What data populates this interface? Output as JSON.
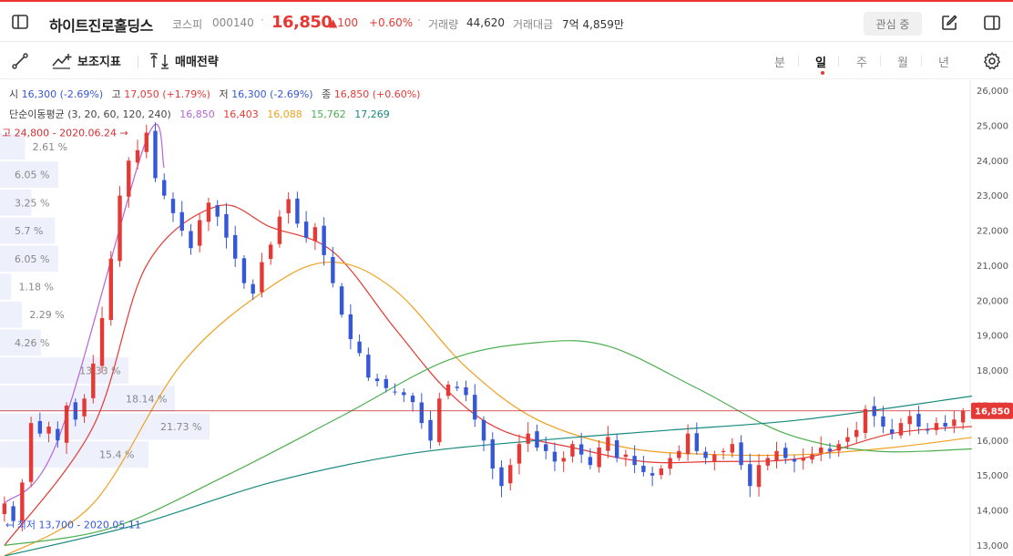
{
  "header": {
    "title": "하이트진로홀딩스",
    "market": "코스피",
    "code": "000140",
    "separator": "·",
    "price": "16,850",
    "change": "▲100",
    "change_pct": "+0.60%",
    "volume_label": "거래량",
    "volume_value": "44,620",
    "amount_label": "거래대금",
    "amount_value": "7억 4,859만",
    "watch_label": "관심 중"
  },
  "toolbar": {
    "indicator_label": "보조지표",
    "strategy_label": "매매전략",
    "periods": [
      "분",
      "일",
      "주",
      "월",
      "년"
    ],
    "active_period": "일"
  },
  "ohlc": {
    "open_label": "시",
    "open": "16,300 (-2.69%)",
    "high_label": "고",
    "high": "17,050 (+1.79%)",
    "low_label": "저",
    "low": "16,300 (-2.69%)",
    "close_label": "종",
    "close": "16,850 (+0.60%)"
  },
  "moving_average": {
    "label": "단순이동평균 (3, 20, 60, 120, 240)",
    "values": [
      {
        "value": "16,850",
        "color": "#b565d8"
      },
      {
        "value": "16,403",
        "color": "#e53935"
      },
      {
        "value": "16,088",
        "color": "#f0a020"
      },
      {
        "value": "15,762",
        "color": "#4caf50"
      },
      {
        "value": "17,269",
        "color": "#17897f"
      }
    ]
  },
  "colors": {
    "up": "#e53935",
    "down": "#3558d8",
    "accent": "#e53935"
  },
  "chart_data": {
    "type": "candlestick",
    "ylim": [
      12700,
      26300
    ],
    "y_ticks": [
      "26,000",
      "25,000",
      "24,000",
      "23,000",
      "22,000",
      "21,000",
      "20,000",
      "19,000",
      "18,000",
      "17,000",
      "16,000",
      "15,000",
      "14,000",
      "13,000"
    ],
    "y_tick_values": [
      26000,
      25000,
      24000,
      23000,
      22000,
      21000,
      20000,
      19000,
      18000,
      17000,
      16000,
      15000,
      14000,
      13000
    ],
    "current_price_label": "16,850",
    "current_price": 16850,
    "high_annotation": "고 24,800 - 2020.06.24 →",
    "high_value": 24800,
    "low_annotation": "← 최저 13,700 - 2020.05.11",
    "low_value": 13700,
    "volume_profile": [
      {
        "price_from": 24000,
        "price_to": 24800,
        "pct": 2.61,
        "label": "2.61 %"
      },
      {
        "price_from": 23200,
        "price_to": 24000,
        "pct": 6.05,
        "label": "6.05 %"
      },
      {
        "price_from": 22400,
        "price_to": 23200,
        "pct": 3.25,
        "label": "3.25 %"
      },
      {
        "price_from": 21600,
        "price_to": 22400,
        "pct": 5.7,
        "label": "5.7 %"
      },
      {
        "price_from": 20800,
        "price_to": 21600,
        "pct": 6.05,
        "label": "6.05 %"
      },
      {
        "price_from": 20000,
        "price_to": 20800,
        "pct": 1.18,
        "label": "1.18 %"
      },
      {
        "price_from": 19200,
        "price_to": 20000,
        "pct": 2.29,
        "label": "2.29 %"
      },
      {
        "price_from": 18400,
        "price_to": 19200,
        "pct": 4.26,
        "label": "4.26 %"
      },
      {
        "price_from": 17600,
        "price_to": 18400,
        "pct": 13.33,
        "label": "13.33 %"
      },
      {
        "price_from": 16800,
        "price_to": 17600,
        "pct": 18.14,
        "label": "18.14 %"
      },
      {
        "price_from": 16000,
        "price_to": 16800,
        "pct": 21.73,
        "label": "21.73 %"
      },
      {
        "price_from": 15200,
        "price_to": 16000,
        "pct": 15.4,
        "label": "15.4 %"
      }
    ],
    "close_path": [
      14200,
      13700,
      14800,
      16500,
      16200,
      16400,
      16000,
      17000,
      16600,
      17200,
      18200,
      19500,
      21200,
      23000,
      24000,
      24300,
      24800,
      23500,
      23000,
      22500,
      22000,
      21500,
      22300,
      22800,
      22400,
      21800,
      21200,
      20500,
      20200,
      21100,
      21600,
      22400,
      22900,
      22200,
      21800,
      22100,
      21300,
      20500,
      19600,
      18900,
      18500,
      17800,
      17700,
      17500,
      17400,
      17300,
      17100,
      16500,
      16000,
      17200,
      17600,
      17500,
      17300,
      16600,
      16000,
      15200,
      14700,
      15300,
      15900,
      16200,
      15800,
      15700,
      15400,
      15500,
      15900,
      15600,
      15300,
      15800,
      16100,
      15500,
      15600,
      15300,
      15100,
      15000,
      15200,
      15500,
      15700,
      16200,
      15700,
      15500,
      15600,
      15700,
      15900,
      15300,
      14700,
      15300,
      15500,
      15700,
      15500,
      15400,
      15500,
      15600,
      15800,
      15700,
      15900,
      16100,
      16300,
      16900,
      16700,
      16400,
      16200,
      16500,
      16700,
      16400,
      16300,
      16500,
      16400,
      16600,
      16850
    ],
    "ma_lines": [
      {
        "period": 3,
        "color": "#b565d8",
        "points": [
          [
            0,
            14200
          ],
          [
            6,
            16000
          ],
          [
            16,
            24600
          ],
          [
            18,
            23800
          ]
        ]
      },
      {
        "period": 20,
        "color": "#e53935",
        "points": [
          [
            0,
            13000
          ],
          [
            10,
            16400
          ],
          [
            16,
            21000
          ],
          [
            24,
            22700
          ],
          [
            30,
            22100
          ],
          [
            37,
            21400
          ],
          [
            44,
            19200
          ],
          [
            50,
            17400
          ],
          [
            56,
            16300
          ],
          [
            64,
            15800
          ],
          [
            72,
            15400
          ],
          [
            80,
            15400
          ],
          [
            90,
            15500
          ],
          [
            100,
            16200
          ],
          [
            109,
            16403
          ]
        ]
      },
      {
        "period": 60,
        "color": "#f0a020",
        "points": [
          [
            0,
            12700
          ],
          [
            10,
            14200
          ],
          [
            20,
            18200
          ],
          [
            30,
            20400
          ],
          [
            37,
            21100
          ],
          [
            44,
            20300
          ],
          [
            52,
            18100
          ],
          [
            60,
            16600
          ],
          [
            70,
            15800
          ],
          [
            80,
            15600
          ],
          [
            90,
            15600
          ],
          [
            100,
            15800
          ],
          [
            109,
            16088
          ]
        ]
      },
      {
        "period": 120,
        "color": "#4caf50",
        "points": [
          [
            0,
            13000
          ],
          [
            12,
            13500
          ],
          [
            25,
            15000
          ],
          [
            38,
            16700
          ],
          [
            50,
            18300
          ],
          [
            60,
            18800
          ],
          [
            68,
            18700
          ],
          [
            78,
            17500
          ],
          [
            88,
            16200
          ],
          [
            98,
            15700
          ],
          [
            109,
            15762
          ]
        ]
      },
      {
        "period": 240,
        "color": "#17897f",
        "points": [
          [
            0,
            12700
          ],
          [
            15,
            13600
          ],
          [
            30,
            14800
          ],
          [
            45,
            15600
          ],
          [
            60,
            16000
          ],
          [
            75,
            16300
          ],
          [
            90,
            16600
          ],
          [
            109,
            17269
          ]
        ]
      }
    ]
  }
}
